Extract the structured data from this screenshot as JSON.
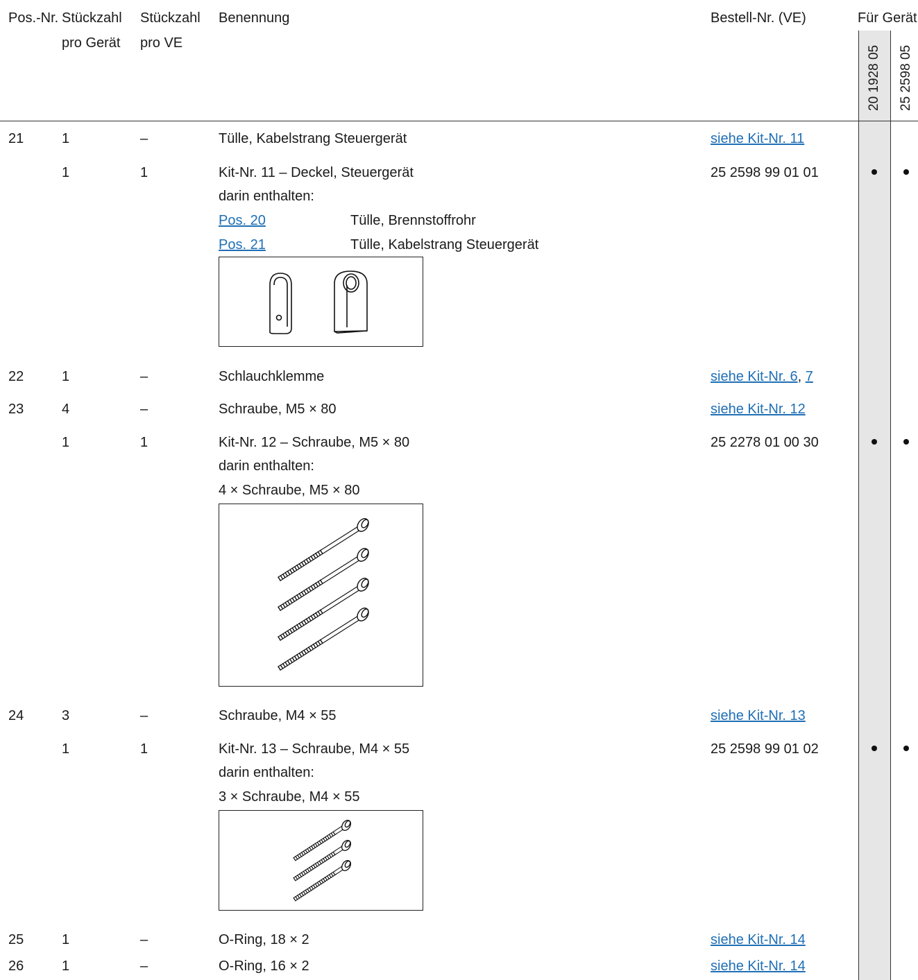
{
  "header": {
    "pos": "Pos.-Nr.",
    "qty_device_1": "Stückzahl",
    "qty_device_2": "pro Gerät",
    "qty_ve_1": "Stückzahl",
    "qty_ve_2": "pro VE",
    "name": "Benennung",
    "order": "Bestell-Nr. (VE)",
    "for_device": "Für Gerät",
    "device_1": "20 1928 05",
    "device_2": "25 2598 05"
  },
  "rows": [
    {
      "pos": "21",
      "qty": "1",
      "ve": "–",
      "name": "Tülle, Kabelstrang Steuergerät",
      "order": "siehe Kit-Nr. 11"
    },
    {
      "pos": "",
      "qty": "1",
      "ve": "1",
      "name": "Kit-Nr. 11 – Deckel, Steuergerät",
      "contains": "darin enthalten:",
      "order": "25 2598 99 01 01"
    },
    {
      "pos": "22",
      "qty": "1",
      "ve": "–",
      "name": "Schlauchklemme",
      "order_prefix": "siehe Kit-Nr. 6",
      "order_sep": ",",
      "order_suffix": "7"
    },
    {
      "pos": "23",
      "qty": "4",
      "ve": "–",
      "name": "Schraube, M5 × 80",
      "order": "siehe Kit-Nr. 12"
    },
    {
      "pos": "",
      "qty": "1",
      "ve": "1",
      "name": "Kit-Nr. 12 – Schraube, M5 × 80",
      "contains": "darin enthalten:",
      "item": "4 × Schraube, M5 × 80",
      "order": "25 2278 01 00 30"
    },
    {
      "pos": "24",
      "qty": "3",
      "ve": "–",
      "name": "Schraube, M4 × 55",
      "order": "siehe Kit-Nr. 13"
    },
    {
      "pos": "",
      "qty": "1",
      "ve": "1",
      "name": "Kit-Nr. 13 – Schraube, M4 × 55",
      "contains": "darin enthalten:",
      "item": "3 × Schraube, M4 × 55",
      "order": "25 2598 99 01 02"
    },
    {
      "pos": "25",
      "qty": "1",
      "ve": "–",
      "name": "O-Ring, 18 × 2",
      "order": "siehe Kit-Nr. 14"
    },
    {
      "pos": "26",
      "qty": "1",
      "ve": "–",
      "name": "O-Ring, 16 × 2",
      "order": "siehe Kit-Nr. 14"
    }
  ],
  "kit11_items": [
    {
      "ref": "Pos. 20",
      "desc": "Tülle, Brennstoffrohr"
    },
    {
      "ref": "Pos. 21",
      "desc": "Tülle, Kabelstrang Steuergerät"
    }
  ],
  "colors": {
    "link": "#1f6fb5",
    "device_column": "#e6e6e6"
  }
}
